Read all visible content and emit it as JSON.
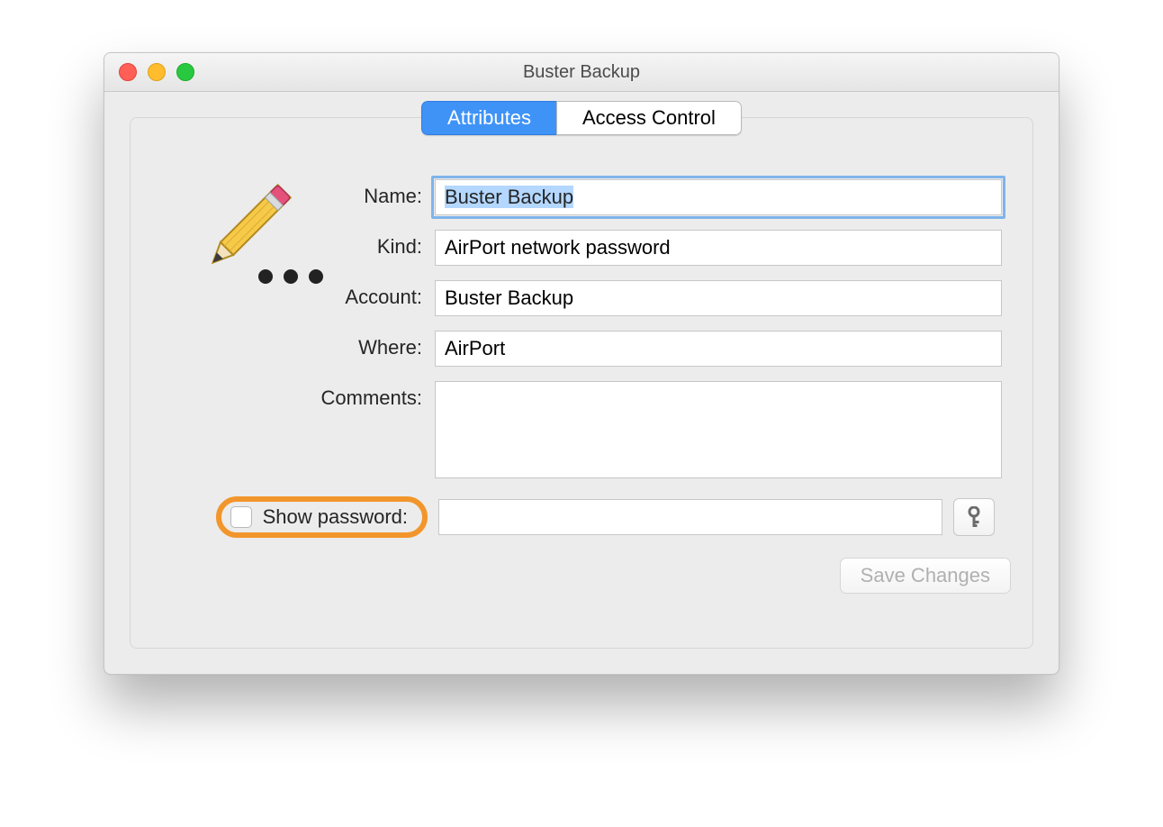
{
  "window": {
    "title": "Buster Backup"
  },
  "tabs": {
    "attributes": "Attributes",
    "access_control": "Access Control",
    "active": "attributes"
  },
  "icon": {
    "name": "pencil-password-icon"
  },
  "fields": {
    "name": {
      "label": "Name:",
      "value": "Buster Backup"
    },
    "kind": {
      "label": "Kind:",
      "value": "AirPort network password"
    },
    "account": {
      "label": "Account:",
      "value": "Buster Backup"
    },
    "where": {
      "label": "Where:",
      "value": "AirPort"
    },
    "comments": {
      "label": "Comments:",
      "value": ""
    }
  },
  "show_password": {
    "label": "Show password:",
    "checked": false,
    "value": ""
  },
  "buttons": {
    "save": "Save Changes"
  },
  "annotation": {
    "highlight_target": "show-password-checkbox",
    "color": "#f2962c"
  }
}
